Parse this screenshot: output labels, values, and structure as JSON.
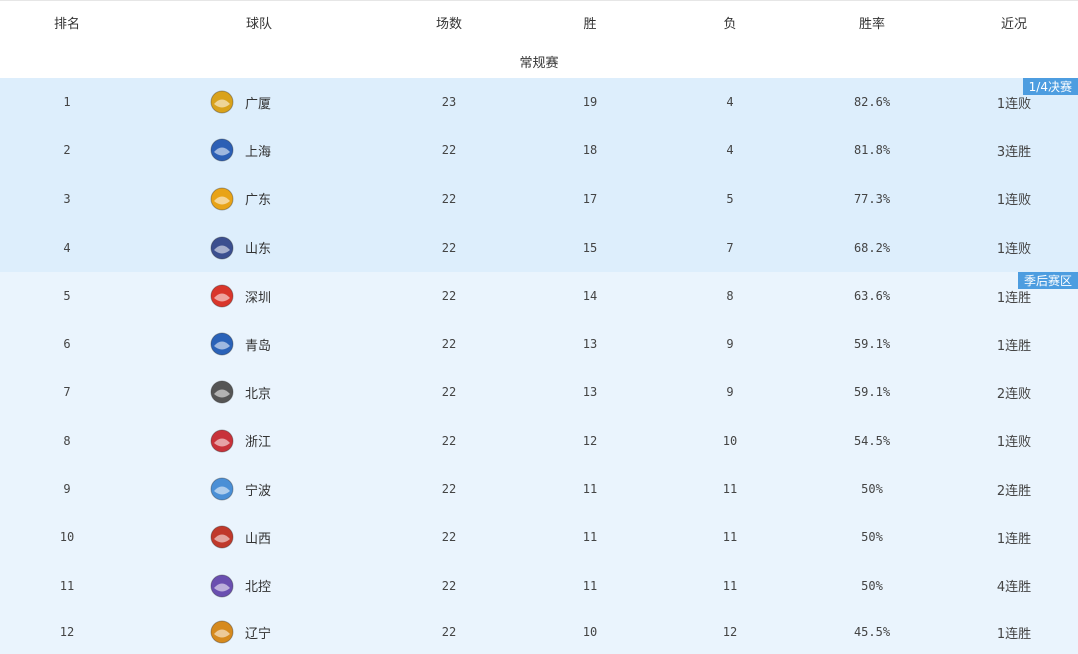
{
  "headers": {
    "rank": "排名",
    "team": "球队",
    "games": "场数",
    "win": "胜",
    "loss": "负",
    "pct": "胜率",
    "recent": "近况"
  },
  "season_label": "常规赛",
  "zones": {
    "quarterfinal": {
      "label": "1/4决赛",
      "color": "#ddeefc",
      "tag_color": "#4d9de0"
    },
    "playoff": {
      "label": "季后赛区",
      "color": "#eaf4fd",
      "tag_color": "#4d9de0"
    }
  },
  "rows": [
    {
      "rank": "1",
      "team": "广厦",
      "games": "23",
      "win": "19",
      "loss": "4",
      "pct": "82.6%",
      "recent": "1连败",
      "logo_icon": "guangsha-logo-icon",
      "logo_color": "#d9a21b"
    },
    {
      "rank": "2",
      "team": "上海",
      "games": "22",
      "win": "18",
      "loss": "4",
      "pct": "81.8%",
      "recent": "3连胜",
      "logo_icon": "shanghai-logo-icon",
      "logo_color": "#2c5fb5"
    },
    {
      "rank": "3",
      "team": "广东",
      "games": "22",
      "win": "17",
      "loss": "5",
      "pct": "77.3%",
      "recent": "1连败",
      "logo_icon": "guangdong-logo-icon",
      "logo_color": "#e8a317"
    },
    {
      "rank": "4",
      "team": "山东",
      "games": "22",
      "win": "15",
      "loss": "7",
      "pct": "68.2%",
      "recent": "1连败",
      "logo_icon": "shandong-logo-icon",
      "logo_color": "#3b4f8f"
    },
    {
      "rank": "5",
      "team": "深圳",
      "games": "22",
      "win": "14",
      "loss": "8",
      "pct": "63.6%",
      "recent": "1连胜",
      "logo_icon": "shenzhen-logo-icon",
      "logo_color": "#d9362b"
    },
    {
      "rank": "6",
      "team": "青岛",
      "games": "22",
      "win": "13",
      "loss": "9",
      "pct": "59.1%",
      "recent": "1连胜",
      "logo_icon": "qingdao-logo-icon",
      "logo_color": "#2a62b8"
    },
    {
      "rank": "7",
      "team": "北京",
      "games": "22",
      "win": "13",
      "loss": "9",
      "pct": "59.1%",
      "recent": "2连败",
      "logo_icon": "beijing-logo-icon",
      "logo_color": "#555555"
    },
    {
      "rank": "8",
      "team": "浙江",
      "games": "22",
      "win": "12",
      "loss": "10",
      "pct": "54.5%",
      "recent": "1连败",
      "logo_icon": "zhejiang-logo-icon",
      "logo_color": "#c8323a"
    },
    {
      "rank": "9",
      "team": "宁波",
      "games": "22",
      "win": "11",
      "loss": "11",
      "pct": "50%",
      "recent": "2连胜",
      "logo_icon": "ningbo-logo-icon",
      "logo_color": "#4a8fd6"
    },
    {
      "rank": "10",
      "team": "山西",
      "games": "22",
      "win": "11",
      "loss": "11",
      "pct": "50%",
      "recent": "1连胜",
      "logo_icon": "shanxi-logo-icon",
      "logo_color": "#c0392b"
    },
    {
      "rank": "11",
      "team": "北控",
      "games": "22",
      "win": "11",
      "loss": "11",
      "pct": "50%",
      "recent": "4连胜",
      "logo_icon": "beikong-logo-icon",
      "logo_color": "#6a4fb0"
    },
    {
      "rank": "12",
      "team": "辽宁",
      "games": "22",
      "win": "10",
      "loss": "12",
      "pct": "45.5%",
      "recent": "1连胜",
      "logo_icon": "liaoning-logo-icon",
      "logo_color": "#d68a1e"
    }
  ]
}
